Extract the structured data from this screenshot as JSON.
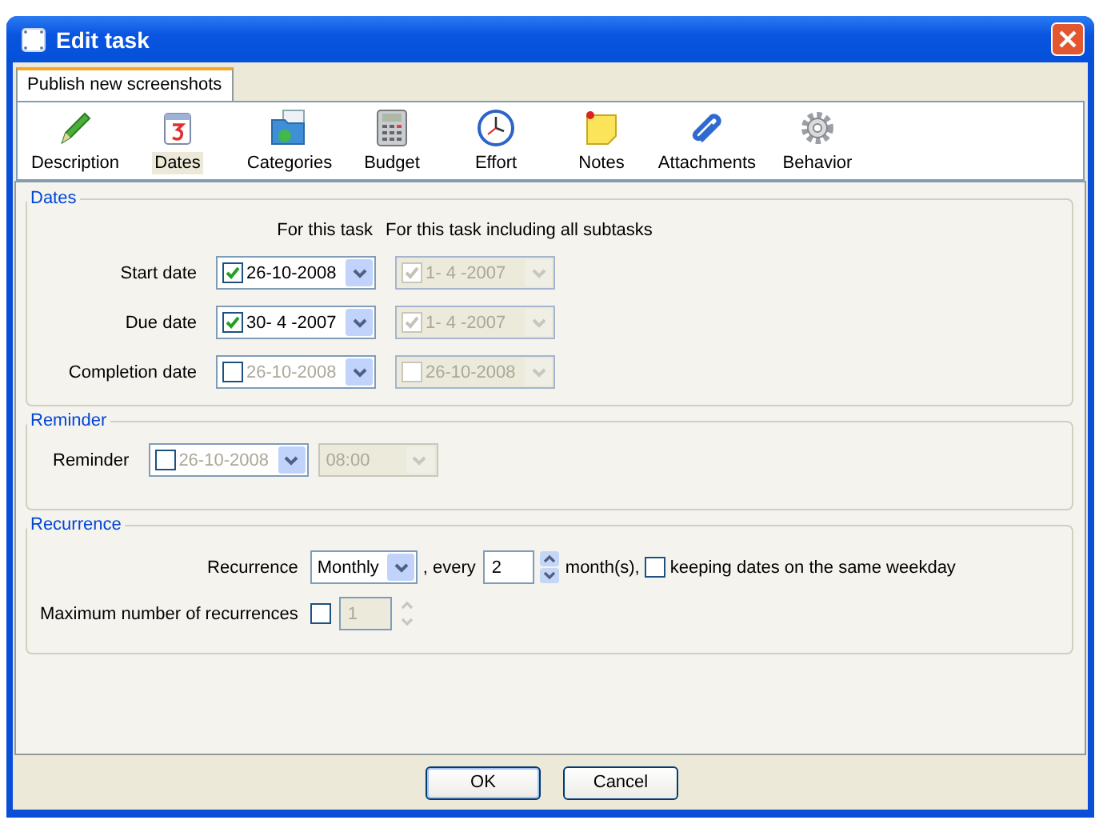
{
  "window": {
    "title": "Edit task"
  },
  "tabs": [
    {
      "label": "Publish new screenshots",
      "selected": true
    }
  ],
  "toolbar": [
    {
      "label": "Description",
      "selected": false
    },
    {
      "label": "Dates",
      "selected": true
    },
    {
      "label": "Categories",
      "selected": false
    },
    {
      "label": "Budget",
      "selected": false
    },
    {
      "label": "Effort",
      "selected": false
    },
    {
      "label": "Notes",
      "selected": false
    },
    {
      "label": "Attachments",
      "selected": false
    },
    {
      "label": "Behavior",
      "selected": false
    }
  ],
  "dates": {
    "title": "Dates",
    "column_headers": [
      "For this task",
      "For this task including all subtasks"
    ],
    "rows": [
      {
        "label": "Start date",
        "fields": [
          {
            "checked": true,
            "value": "26-10-2008",
            "disabled": false
          },
          {
            "checked": true,
            "value": "1- 4 -2007",
            "disabled": true
          }
        ]
      },
      {
        "label": "Due date",
        "fields": [
          {
            "checked": true,
            "value": "30- 4 -2007",
            "disabled": false
          },
          {
            "checked": true,
            "value": "1- 4 -2007",
            "disabled": true
          }
        ]
      },
      {
        "label": "Completion date",
        "fields": [
          {
            "checked": false,
            "value": "26-10-2008",
            "disabled": false
          },
          {
            "checked": false,
            "value": "26-10-2008",
            "disabled": true
          }
        ]
      }
    ]
  },
  "reminder": {
    "title": "Reminder",
    "label": "Reminder",
    "date": {
      "checked": false,
      "value": "26-10-2008",
      "disabled": false
    },
    "time": {
      "value": "08:00",
      "disabled": true
    }
  },
  "recurrence": {
    "title": "Recurrence",
    "label": "Recurrence",
    "period": "Monthly",
    "every_label": ", every",
    "amount": "2",
    "unit_label": "month(s),",
    "same_weekday": {
      "checked": false,
      "label": "keeping dates on the same weekday"
    },
    "max_label": "Maximum number of recurrences",
    "max": {
      "checked": false,
      "value": "1",
      "disabled": true
    }
  },
  "buttons": [
    {
      "label": "OK",
      "default": true
    },
    {
      "label": "Cancel",
      "default": false
    }
  ]
}
